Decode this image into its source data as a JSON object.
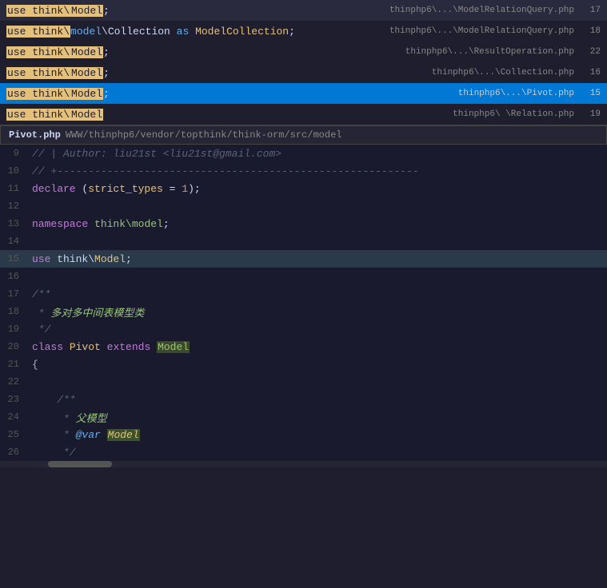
{
  "autocomplete": {
    "items": [
      {
        "id": 0,
        "prefix": "use think\\",
        "suffix": "Model",
        "semicolon": ";",
        "file": "thinphp6\\...\\ModelRelationQuery.php",
        "line": "17",
        "selected": false
      },
      {
        "id": 1,
        "prefix": "use think\\",
        "suffix": "model\\Collection as ModelCollection",
        "semicolon": ";",
        "file": "thinphp6\\...\\ModelRelationQuery.php",
        "line": "18",
        "selected": false
      },
      {
        "id": 2,
        "prefix": "use think\\",
        "suffix": "Model",
        "semicolon": ";",
        "file": "thinphp6\\...\\ResultOperation.php",
        "line": "22",
        "selected": false
      },
      {
        "id": 3,
        "prefix": "use think\\",
        "suffix": "Model",
        "semicolon": ";",
        "file": "thinphp6\\...\\Collection.php",
        "line": "16",
        "selected": false
      },
      {
        "id": 4,
        "prefix": "use think\\",
        "suffix": "Model",
        "semicolon": ";",
        "file": "thinphp6\\...\\Pivot.php",
        "line": "15",
        "selected": true
      },
      {
        "id": 5,
        "prefix": "use think\\",
        "suffix": "Model",
        "semicolon": "",
        "file": "thinphp6\\\\Relation.php",
        "line": "19",
        "selected": false,
        "partial": true
      }
    ]
  },
  "tooltip": {
    "filename": "Pivot.php",
    "filepath": "WWW/thinphp6/vendor/topthink/think-orm/src/model"
  },
  "code": {
    "lines": [
      {
        "num": "9",
        "content": "// | Author: liu21st <liu21st@gmail.com>",
        "type": "comment"
      },
      {
        "num": "10",
        "content": "// +----------------------------------------------------------",
        "type": "comment"
      },
      {
        "num": "11",
        "content": "declare (strict_types = 1);",
        "type": "declare"
      },
      {
        "num": "12",
        "content": "",
        "type": "empty"
      },
      {
        "num": "13",
        "content": "namespace think\\model;",
        "type": "namespace"
      },
      {
        "num": "14",
        "content": "",
        "type": "empty"
      },
      {
        "num": "15",
        "content": "use think\\Model;",
        "type": "use",
        "active": true
      },
      {
        "num": "16",
        "content": "",
        "type": "empty"
      },
      {
        "num": "17",
        "content": "/**",
        "type": "comment_block"
      },
      {
        "num": "18",
        "content": " * 多对多中间表模型类",
        "type": "comment_block"
      },
      {
        "num": "19",
        "content": " */",
        "type": "comment_block"
      },
      {
        "num": "20",
        "content": "class Pivot extends Model",
        "type": "class"
      },
      {
        "num": "21",
        "content": "{",
        "type": "brace"
      },
      {
        "num": "22",
        "content": "",
        "type": "empty"
      },
      {
        "num": "23",
        "content": "    /**",
        "type": "comment_block"
      },
      {
        "num": "24",
        "content": "     * 父模型",
        "type": "comment_block"
      },
      {
        "num": "25",
        "content": "     * @var Model",
        "type": "comment_block_var"
      },
      {
        "num": "26",
        "content": "     */",
        "type": "comment_block"
      }
    ]
  }
}
